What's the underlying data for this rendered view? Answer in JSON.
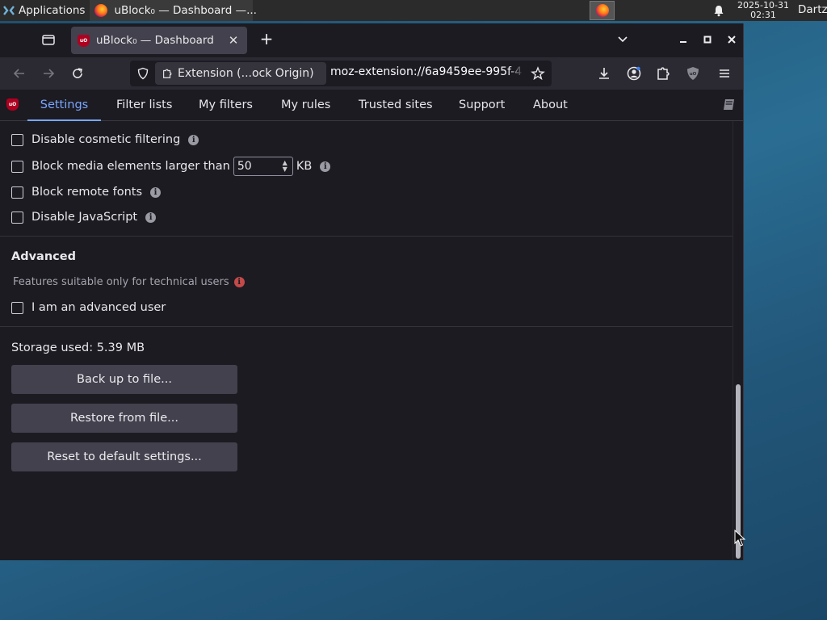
{
  "panel": {
    "applications": "Applications",
    "task_title": "uBlock₀ — Dashboard —...",
    "clock_date": "2025-10-31",
    "clock_time": "02:31",
    "user": "Dartz"
  },
  "browser": {
    "tab_title": "uBlock₀ — Dashboard",
    "identity_label": "Extension (...ock Origin)",
    "url": "moz-extension://6a9459ee-995f-4",
    "new_tab": "+",
    "tab_close": "✕"
  },
  "dashboard": {
    "tabs": [
      {
        "label": "Settings",
        "active": true
      },
      {
        "label": "Filter lists"
      },
      {
        "label": "My filters"
      },
      {
        "label": "My rules"
      },
      {
        "label": "Trusted sites"
      },
      {
        "label": "Support"
      },
      {
        "label": "About"
      }
    ],
    "options": {
      "disable_cosmetic": "Disable cosmetic filtering",
      "block_media_prefix": "Block media elements larger than",
      "block_media_value": "50",
      "block_media_unit": "KB",
      "block_fonts": "Block remote fonts",
      "disable_js": "Disable JavaScript"
    },
    "advanced": {
      "title": "Advanced",
      "subtitle": "Features suitable only for technical users",
      "advanced_user": "I am an advanced user"
    },
    "storage_used": "Storage used: 5.39 MB",
    "buttons": {
      "backup": "Back up to file...",
      "restore": "Restore from file...",
      "reset": "Reset to default settings..."
    }
  },
  "colors": {
    "accent": "#7aa6ff",
    "ublock_red": "#b00020"
  },
  "icons": {
    "info": "i"
  }
}
